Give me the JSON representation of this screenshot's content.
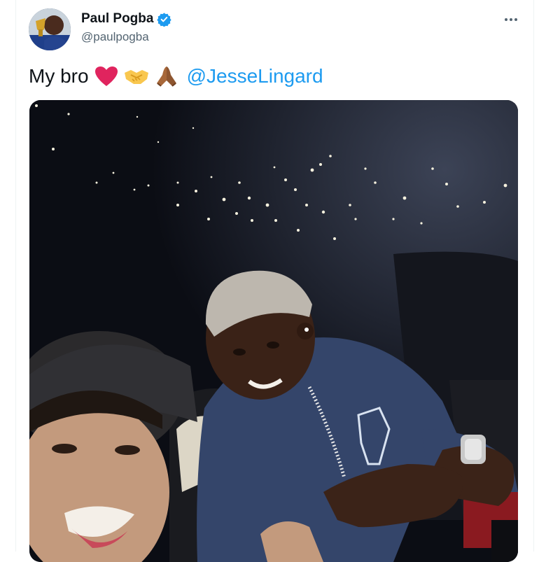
{
  "tweet": {
    "display_name": "Paul Pogba",
    "handle": "@paulpogba",
    "verified": true,
    "text": "My bro",
    "emojis": [
      "red-heart-icon",
      "handshake-icon",
      "folded-hands-icon"
    ],
    "mention": "@JesseLingard",
    "media": {
      "type": "photo",
      "icon": "selfie-photo"
    }
  },
  "colors": {
    "accent": "#1d9bf0",
    "text": "#0f1419",
    "secondary": "#536471",
    "heart": "#e0245e"
  }
}
